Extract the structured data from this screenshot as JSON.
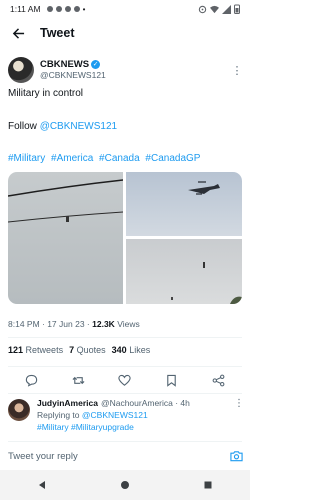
{
  "status_bar": {
    "time": "1:11 AM"
  },
  "header": {
    "title": "Tweet"
  },
  "author": {
    "name": "CBKNEWS",
    "handle": "@CBKNEWS121"
  },
  "tweet": {
    "text": "Military in control",
    "follow_prefix": "Follow",
    "follow_link": "@CBKNEWS121",
    "hashtags": [
      "#Military",
      "#America",
      "#Canada",
      "#CanadaGP"
    ]
  },
  "meta": {
    "time_date": "8:14 PM · 17 Jun 23 ·",
    "views_count": "12.3K",
    "views_label": "Views"
  },
  "stats": {
    "retweets_count": "121",
    "retweets_label": "Retweets",
    "quotes_count": "7",
    "quotes_label": "Quotes",
    "likes_count": "340",
    "likes_label": "Likes"
  },
  "reply": {
    "name": "JudyinAmerica",
    "handle_time": "@NachourAmerica · 4h",
    "replying_to_prefix": "Replying to",
    "replying_to_handle": "@CBKNEWS121",
    "hashtags": "#Military #Militaryupgrade"
  },
  "compose": {
    "placeholder": "Tweet your reply"
  },
  "colors": {
    "link": "#1d9bf0",
    "text": "#0f1419",
    "muted": "#536471"
  }
}
